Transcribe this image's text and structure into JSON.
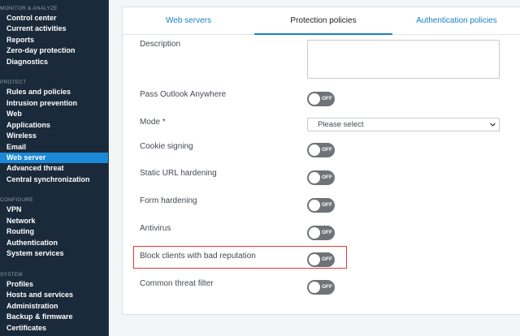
{
  "sidebar": {
    "sections": [
      {
        "label": "MONITOR & ANALYZE",
        "items": [
          "Control center",
          "Current activities",
          "Reports",
          "Zero-day protection",
          "Diagnostics"
        ]
      },
      {
        "label": "PROTECT",
        "items": [
          "Rules and policies",
          "Intrusion prevention",
          "Web",
          "Applications",
          "Wireless",
          "Email",
          "Web server",
          "Advanced threat",
          "Central synchronization"
        ]
      },
      {
        "label": "CONFIGURE",
        "items": [
          "VPN",
          "Network",
          "Routing",
          "Authentication",
          "System services"
        ]
      },
      {
        "label": "SYSTEM",
        "items": [
          "Profiles",
          "Hosts and services",
          "Administration",
          "Backup & firmware",
          "Certificates"
        ]
      }
    ],
    "active_item": "Web server"
  },
  "tabs": [
    "Web servers",
    "Protection policies",
    "Authentication policies"
  ],
  "active_tab": "Protection policies",
  "form": {
    "description_label": "Description",
    "description_value": "",
    "pass_outlook_label": "Pass Outlook Anywhere",
    "mode_label": "Mode *",
    "mode_value": "Please select",
    "cookie_signing_label": "Cookie signing",
    "static_url_label": "Static URL hardening",
    "form_hardening_label": "Form hardening",
    "antivirus_label": "Antivirus",
    "block_clients_label": "Block clients with bad reputation",
    "common_threat_label": "Common threat filter",
    "toggle_off_text": "OFF"
  },
  "colors": {
    "sidebar_bg": "#1b2a3a",
    "active_item_bg": "#1a8ad6",
    "tab_link": "#1a7ec6",
    "toggle_off_bg": "#6f7378",
    "highlight_border": "#e53935"
  },
  "icons": {
    "select_arrow": "chevron-down-icon",
    "textarea_resize": "resize-grip-icon"
  }
}
